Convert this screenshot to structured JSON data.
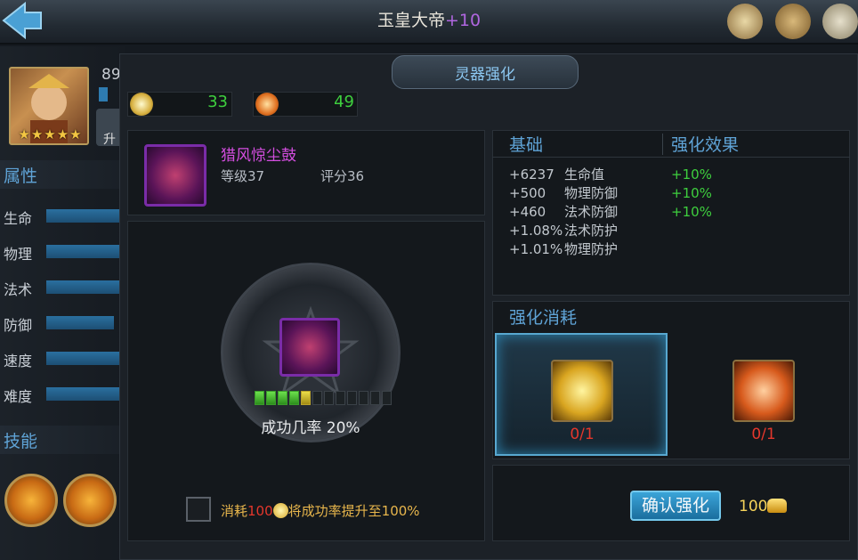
{
  "header": {
    "title": "玉皇大帝",
    "plus": "+10"
  },
  "hero": {
    "level": "89",
    "up_label": "升",
    "stars": 5
  },
  "sections": {
    "attributes": "属性",
    "skills": "技能"
  },
  "attributes": [
    "生命",
    "物理",
    "法术",
    "防御",
    "速度",
    "难度"
  ],
  "panel": {
    "title": "灵器强化"
  },
  "currency": [
    {
      "icon": "orb-icon",
      "value": "33"
    },
    {
      "icon": "swirl-icon",
      "value": "49"
    }
  ],
  "item": {
    "name": "猎风惊尘鼓",
    "level": "等级37",
    "score": "评分36"
  },
  "enhance": {
    "rate_label": "成功几率 20%",
    "pips_full": 4,
    "pips_half": 1,
    "pips_total": 12
  },
  "cost_option": {
    "prefix": "消耗",
    "amount": "100",
    "suffix": "将成功率提升至100%"
  },
  "stats": {
    "base_header": "基础",
    "effect_header": "强化效果",
    "rows": [
      {
        "value": "+6237",
        "name": "生命值",
        "effect": "+10%"
      },
      {
        "value": "+500",
        "name": "物理防御",
        "effect": "+10%"
      },
      {
        "value": "+460",
        "name": "法术防御",
        "effect": "+10%"
      },
      {
        "value": "+1.08%",
        "name": "法术防护",
        "effect": ""
      },
      {
        "value": "+1.01%",
        "name": "物理防护",
        "effect": ""
      }
    ]
  },
  "materials": {
    "header": "强化消耗",
    "items": [
      {
        "icon": "gold-crystal-icon",
        "count": "0/1"
      },
      {
        "icon": "fire-crystal-icon",
        "count": "0/1"
      }
    ]
  },
  "confirm": {
    "label": "确认强化",
    "gold": "100"
  }
}
